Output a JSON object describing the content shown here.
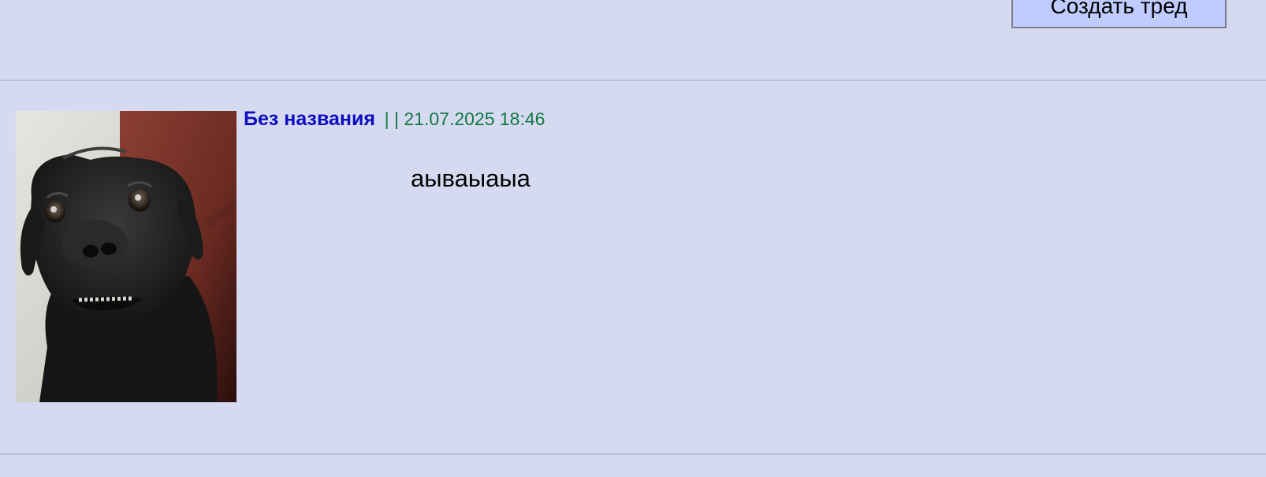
{
  "header": {
    "create_thread_label": "Создать тред"
  },
  "post": {
    "subject": "Без названия",
    "meta": "| | 21.07.2025 18:46",
    "message": "аываыаыа",
    "thumbnail_icon": "black-dog-photo"
  },
  "colors": {
    "background": "#d6daf0",
    "subject": "#0f0cc0",
    "meta": "#117743",
    "button_background": "#c0cbff",
    "divider": "#b7c5d9"
  }
}
